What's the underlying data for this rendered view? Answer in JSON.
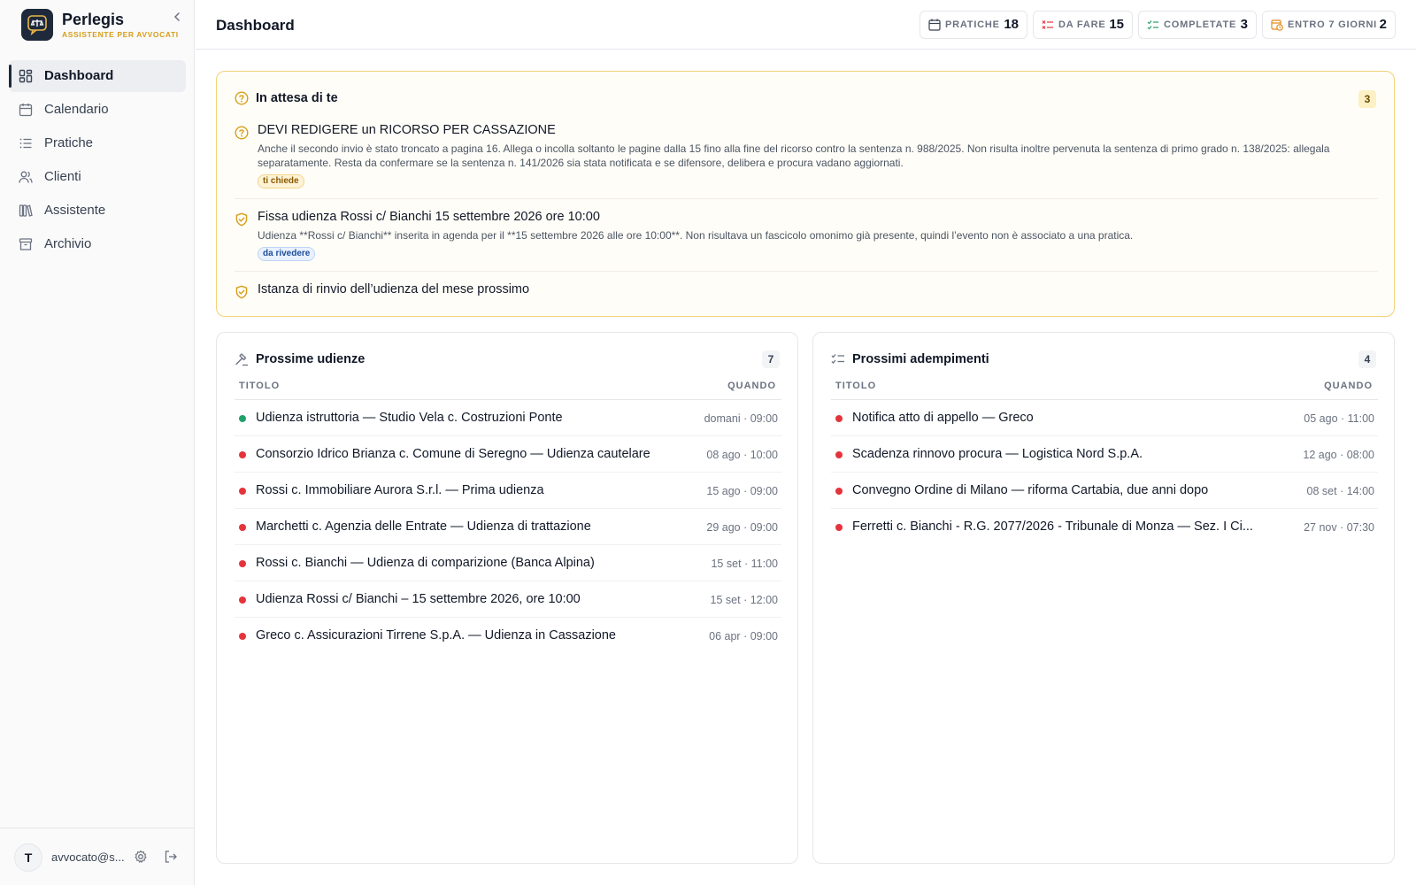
{
  "app": {
    "name": "Perlegis",
    "subtitle": "ASSISTENTE PER AVVOCATI"
  },
  "sidebar": {
    "items": [
      {
        "label": "Dashboard",
        "icon": "dashboard-icon",
        "active": true
      },
      {
        "label": "Calendario",
        "icon": "calendar-icon"
      },
      {
        "label": "Pratiche",
        "icon": "list-icon"
      },
      {
        "label": "Clienti",
        "icon": "users-icon"
      },
      {
        "label": "Assistente",
        "icon": "library-icon"
      },
      {
        "label": "Archivio",
        "icon": "archive-icon"
      }
    ],
    "user": {
      "initial": "T",
      "email": "avvocato@s..."
    }
  },
  "header": {
    "title": "Dashboard",
    "stats": [
      {
        "label": "PRATICHE",
        "value": "18",
        "icon": "calendar-icon"
      },
      {
        "label": "DA FARE",
        "value": "15",
        "icon": "todo-list-icon"
      },
      {
        "label": "COMPLETATE",
        "value": "3",
        "icon": "checklist-icon"
      },
      {
        "label": "ENTRO 7 GIORNI",
        "value": "2",
        "icon": "calendar-clock-icon"
      }
    ]
  },
  "waiting": {
    "title": "In attesa di te",
    "count": "3",
    "items": [
      {
        "icon": "question-circle-icon",
        "title": "DEVI REDIGERE un RICORSO PER CASSAZIONE",
        "description": "Anche il secondo invio è stato troncato a pagina 16. Allega o incolla soltanto le pagine dalla 15 fino alla fine del ricorso contro la sentenza n. 988/2025. Non risulta inoltre pervenuta la sentenza di primo grado n. 138/2025: allegala separatamente. Resta da confermare se la sentenza n. 141/2026 sia stata notificata e se difensore, delibera e procura vadano aggiornati.",
        "tag": "ti chiede"
      },
      {
        "icon": "shield-check-icon",
        "title": "Fissa udienza Rossi c/ Bianchi 15 settembre 2026 ore 10:00",
        "description": "Udienza **Rossi c/ Bianchi** inserita in agenda per il **15 settembre 2026 alle ore 10:00**. Non risultava un fascicolo omonimo già presente, quindi l’evento non è associato a una pratica.",
        "tag": "da rivedere"
      },
      {
        "icon": "shield-check-icon",
        "title": "Istanza di rinvio dell’udienza del mese prossimo"
      }
    ]
  },
  "hearings": {
    "title": "Prossime udienze",
    "count": "7",
    "col_title": "TITOLO",
    "col_when": "QUANDO",
    "rows": [
      {
        "title": "Udienza istruttoria — Studio Vela c. Costruzioni Ponte",
        "when": "domani · 09:00",
        "status": "#22a06b"
      },
      {
        "title": "Consorzio Idrico Brianza c. Comune di Seregno — Udienza cautelare",
        "when": "08 ago · 10:00",
        "status": "#e5333b"
      },
      {
        "title": "Rossi c. Immobiliare Aurora S.r.l. — Prima udienza",
        "when": "15 ago · 09:00",
        "status": "#e5333b"
      },
      {
        "title": "Marchetti c. Agenzia delle Entrate — Udienza di trattazione",
        "when": "29 ago · 09:00",
        "status": "#e5333b"
      },
      {
        "title": "Rossi c. Bianchi — Udienza di comparizione (Banca Alpina)",
        "when": "15 set · 11:00",
        "status": "#e5333b"
      },
      {
        "title": "Udienza Rossi c/ Bianchi – 15 settembre 2026, ore 10:00",
        "when": "15 set · 12:00",
        "status": "#e5333b"
      },
      {
        "title": "Greco c. Assicurazioni Tirrene S.p.A. — Udienza in Cassazione",
        "when": "06 apr · 09:00",
        "status": "#e5333b"
      }
    ]
  },
  "deadlines": {
    "title": "Prossimi adempimenti",
    "count": "4",
    "col_title": "TITOLO",
    "col_when": "QUANDO",
    "rows": [
      {
        "title": "Notifica atto di appello — Greco",
        "when": "05 ago · 11:00",
        "status": "#e5333b"
      },
      {
        "title": "Scadenza rinnovo procura — Logistica Nord S.p.A.",
        "when": "12 ago · 08:00",
        "status": "#e5333b"
      },
      {
        "title": "Convegno Ordine di Milano — riforma Cartabia, due anni dopo",
        "when": "08 set · 14:00",
        "status": "#e5333b"
      },
      {
        "title": "Ferretti c. Bianchi - R.G. 2077/2026 - Tribunale di Monza — Sez. I Ci...",
        "when": "27 nov · 07:30",
        "status": "#e5333b"
      }
    ]
  },
  "colors": {
    "accent": "#1e2a3b",
    "brand_gold": "#d69e1a",
    "warning_border": "#f2d27a",
    "urgent_dot": "#e5333b",
    "ok_dot": "#22a06b"
  }
}
